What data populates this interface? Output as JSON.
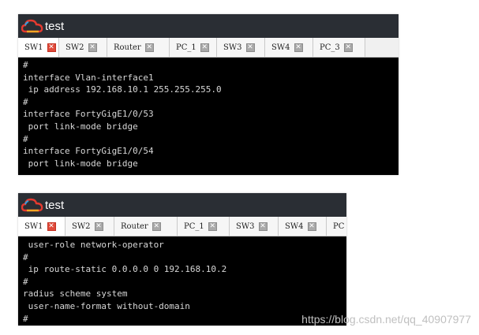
{
  "window1": {
    "title": "test",
    "tabs": [
      {
        "label": "SW1",
        "active": true
      },
      {
        "label": "SW2"
      },
      {
        "label": "Router"
      },
      {
        "label": "PC_1"
      },
      {
        "label": "SW3"
      },
      {
        "label": "SW4"
      },
      {
        "label": "PC_3"
      }
    ],
    "console_lines": [
      "#",
      "interface Vlan-interface1",
      " ip address 192.168.10.1 255.255.255.0",
      "#",
      "interface FortyGigE1/0/53",
      " port link-mode bridge",
      "#",
      "interface FortyGigE1/0/54",
      " port link-mode bridge"
    ]
  },
  "window2": {
    "title": "test",
    "tabs": [
      {
        "label": "SW1",
        "active": true
      },
      {
        "label": "SW2"
      },
      {
        "label": "Router"
      },
      {
        "label": "PC_1"
      },
      {
        "label": "SW3"
      },
      {
        "label": "SW4"
      },
      {
        "label": "PC"
      }
    ],
    "console_lines": [
      " user-role network-operator",
      "#",
      " ip route-static 0.0.0.0 0 192.168.10.2",
      "#",
      "radius scheme system",
      " user-name-format without-domain",
      "#"
    ]
  },
  "close_glyph": "✕",
  "watermark": "https://blog.csdn.net/qq_40907977",
  "colors": {
    "titlebar": "#2a2e34",
    "console_bg": "#000000",
    "console_text": "#d8d8d8",
    "active_close": "#e04a3a"
  }
}
